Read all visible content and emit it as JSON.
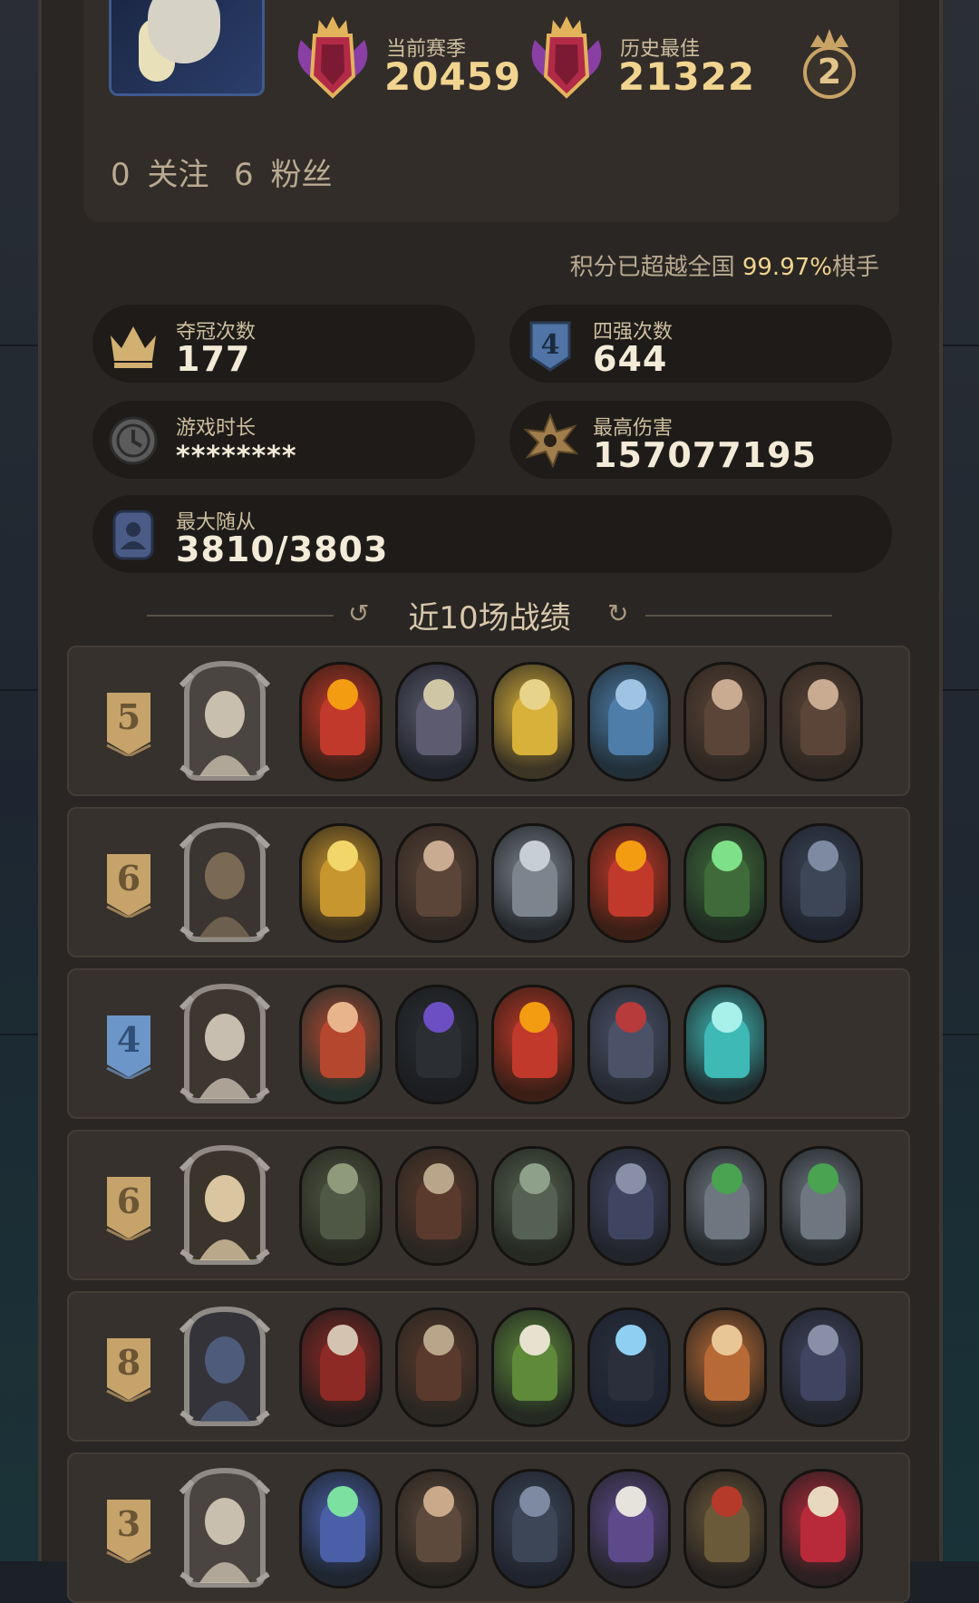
{
  "header": {
    "season_label": "当前赛季",
    "season_score": "20459",
    "best_label": "历史最佳",
    "best_score": "21322",
    "crown_count": "2"
  },
  "social": {
    "follow_count": "0",
    "follow_label": "关注",
    "fans_count": "6",
    "fans_label": "粉丝"
  },
  "percentile": {
    "prefix": "积分已超越全国",
    "value": "99.97%",
    "suffix": "棋手"
  },
  "stats": {
    "wins_label": "夺冠次数",
    "wins_value": "177",
    "top4_label": "四强次数",
    "top4_value": "644",
    "playtime_label": "游戏时长",
    "playtime_value": "********",
    "damage_label": "最高伤害",
    "damage_value": "157077195",
    "followers_label": "最大随从",
    "followers_value": "3810/3803"
  },
  "recent": {
    "title": "近10场战绩",
    "matches": [
      {
        "place": "5",
        "hero": "goat-hero",
        "units": [
          "fire-dragon",
          "skeleton-mage",
          "golden-dragon",
          "blue-dragon",
          "bald-brute",
          "bald-brute"
        ]
      },
      {
        "place": "6",
        "hero": "cat-hero",
        "units": [
          "golden-knight",
          "bald-brute",
          "armored-knight",
          "fire-dragon",
          "poison-plant",
          "dark-gargoyle"
        ]
      },
      {
        "place": "4",
        "hero": "old-man-hero",
        "units": [
          "red-hair-elf",
          "hooded-shadow",
          "fire-dragon",
          "rat-warrior",
          "ghost-soldier"
        ]
      },
      {
        "place": "6",
        "hero": "clock-hero",
        "units": [
          "rock-golem",
          "hedgehog",
          "stone-troll",
          "dark-boar",
          "goblin-knight",
          "goblin-knight"
        ]
      },
      {
        "place": "8",
        "hero": "owl-hero",
        "units": [
          "red-assassin",
          "hedgehog",
          "mandrake",
          "black-panther",
          "deer-warrior",
          "dark-boar"
        ]
      },
      {
        "place": "3",
        "hero": "goat-hero",
        "units": [
          "elf-sorceress",
          "bearded-warrior",
          "dark-gargoyle",
          "old-wizard",
          "shield-knight",
          "jester"
        ]
      }
    ]
  },
  "colors": {
    "gold": "#f1d48f",
    "panel": "#2a2623",
    "card": "#1e1b19",
    "badge_gold": "#c6a36a",
    "badge_blue": "#6d96c8"
  }
}
